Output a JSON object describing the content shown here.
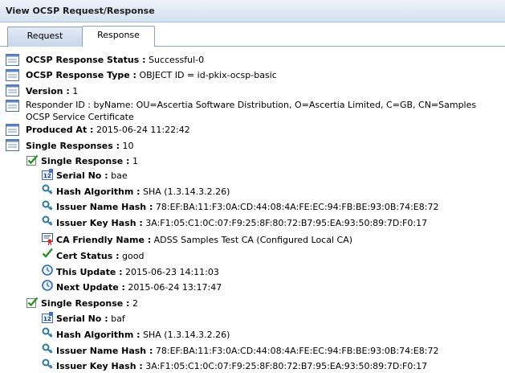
{
  "window": {
    "title": "View OCSP Request/Response"
  },
  "tabs": {
    "request": "Request",
    "response": "Response"
  },
  "fields": {
    "status": {
      "label": "OCSP Response Status :",
      "value": "Successful-0"
    },
    "type": {
      "label": "OCSP Response Type :",
      "value": "OBJECT ID = id-pkix-ocsp-basic"
    },
    "version": {
      "label": "Version :",
      "value": "1"
    },
    "responder": {
      "label": "Responder ID :",
      "value": "byName: OU=Ascertia Software Distribution, O=Ascertia Limited, C=GB, CN=Samples OCSP Service Certificate"
    },
    "produced": {
      "label": "Produced At :",
      "value": "2015-06-24 11:22:42"
    },
    "singles": {
      "label": "Single Responses :",
      "value": "10"
    }
  },
  "single1": {
    "label": "Single Response :",
    "value": "1",
    "serial": {
      "label": "Serial No :",
      "value": "bae"
    },
    "hash_alg": {
      "label": "Hash Algorithm :",
      "value": "SHA (1.3.14.3.2.26)"
    },
    "name_hash": {
      "label": "Issuer Name Hash :",
      "value": "78:EF:BA:11:F3:0A:CD:44:08:4A:FE:EC:94:FB:BE:93:0B:74:E8:72"
    },
    "key_hash": {
      "label": "Issuer Key Hash :",
      "value": "3A:F1:05:C1:0C:07:F9:25:8F:80:72:B7:95:EA:93:50:89:7D:F0:17"
    },
    "ca_name": {
      "label": "CA Friendly Name :",
      "value": "ADSS Samples Test CA (Configured Local CA)"
    },
    "cert_status": {
      "label": "Cert Status :",
      "value": "good"
    },
    "this_update": {
      "label": "This Update :",
      "value": "2015-06-23 14:11:03"
    },
    "next_update": {
      "label": "Next Update :",
      "value": "2015-06-24 13:17:47"
    }
  },
  "single2": {
    "label": "Single Response :",
    "value": "2",
    "serial": {
      "label": "Serial No :",
      "value": "baf"
    },
    "hash_alg": {
      "label": "Hash Algorithm :",
      "value": "SHA (1.3.14.3.2.26)"
    },
    "name_hash": {
      "label": "Issuer Name Hash :",
      "value": "78:EF:BA:11:F3:0A:CD:44:08:4A:FE:EC:94:FB:BE:93:0B:74:E8:72"
    },
    "key_hash": {
      "label": "Issuer Key Hash :",
      "value": "3A:F1:05:C1:0C:07:F9:25:8F:80:72:B7:95:EA:93:50:89:7D:F0:17"
    }
  }
}
